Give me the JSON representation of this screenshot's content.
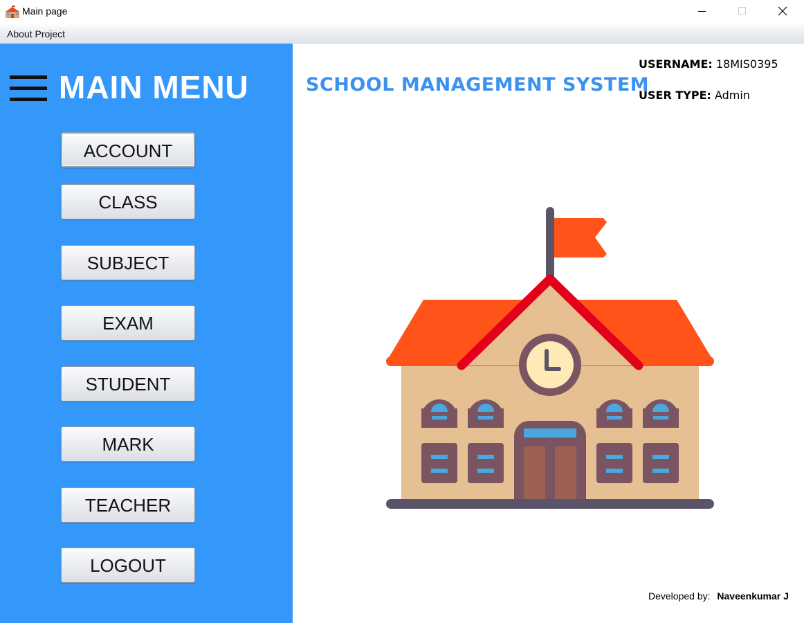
{
  "window": {
    "title": "Main page",
    "controls": [
      "minimize",
      "maximize",
      "close"
    ]
  },
  "menubar": {
    "items": [
      {
        "label": "About Project"
      }
    ]
  },
  "sidebar": {
    "title": "MAIN MENU",
    "buttons": [
      {
        "label": "ACCOUNT"
      },
      {
        "label": "CLASS"
      },
      {
        "label": "SUBJECT"
      },
      {
        "label": "EXAM"
      },
      {
        "label": "STUDENT"
      },
      {
        "label": "MARK"
      },
      {
        "label": "TEACHER"
      },
      {
        "label": "LOGOUT"
      }
    ]
  },
  "main": {
    "title": "SCHOOL MANAGEMENT SYSTEM",
    "username_label": "USERNAME:",
    "username": "18MIS0395",
    "usertype_label": "USER TYPE:",
    "usertype": "Admin",
    "illustration": "school-building-icon",
    "footer_label": "Developed by:",
    "footer_name": "Naveenkumar J"
  },
  "colors": {
    "sidebar_bg": "#3498fb",
    "title_blue": "#3a92f0",
    "roof": "#ff5319",
    "wall": "#e6bf93",
    "trim": "#7a5561"
  }
}
